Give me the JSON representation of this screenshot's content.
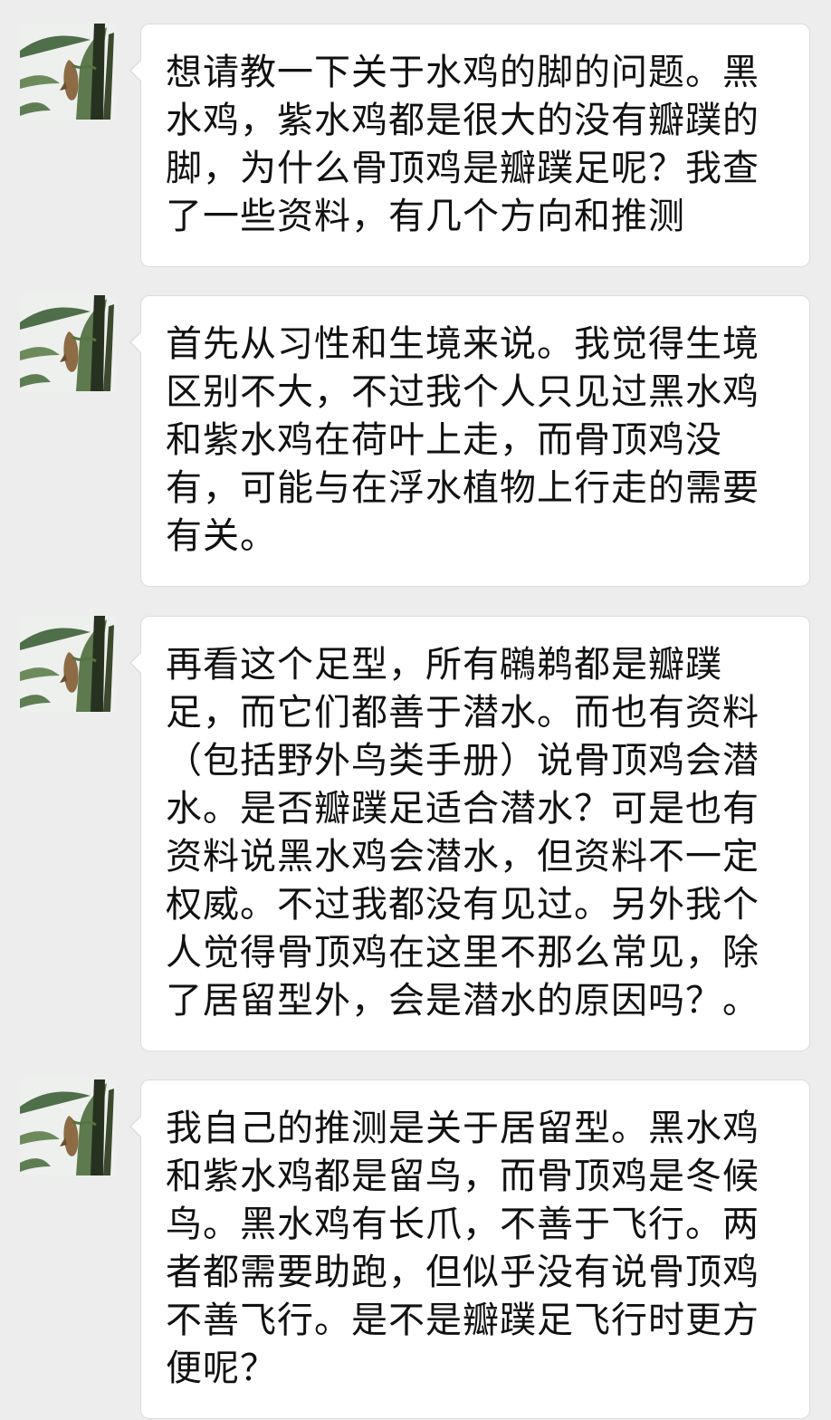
{
  "conversation": {
    "messages": [
      {
        "avatar_icon": "plant-leaf-avatar-icon",
        "text": "想请教一下关于水鸡的脚的问题。黑水鸡，紫水鸡都是很大的没有瓣蹼的脚，为什么骨顶鸡是瓣蹼足呢？我查了一些资料，有几个方向和推测"
      },
      {
        "avatar_icon": "plant-leaf-avatar-icon",
        "text": "首先从习性和生境来说。我觉得生境区别不大，不过我个人只见过黑水鸡和紫水鸡在荷叶上走，而骨顶鸡没有，可能与在浮水植物上行走的需要有关。"
      },
      {
        "avatar_icon": "plant-leaf-avatar-icon",
        "text": "再看这个足型，所有鸊鹈都是瓣蹼足，而它们都善于潜水。而也有资料（包括野外鸟类手册）说骨顶鸡会潜水。是否瓣蹼足适合潜水？可是也有资料说黑水鸡会潜水，但资料不一定权威。不过我都没有见过。另外我个人觉得骨顶鸡在这里不那么常见，除了居留型外，会是潜水的原因吗？。"
      },
      {
        "avatar_icon": "plant-leaf-avatar-icon",
        "text": "我自己的推测是关于居留型。黑水鸡和紫水鸡都是留鸟，而骨顶鸡是冬候鸟。黑水鸡有长爪，不善于飞行。两者都需要助跑，但似乎没有说骨顶鸡不善飞行。是不是瓣蹼足飞行时更方便呢？"
      }
    ]
  },
  "colors": {
    "background": "#ededed",
    "bubble": "#ffffff",
    "bubble_border": "#dcdcdc",
    "text": "#111111"
  }
}
